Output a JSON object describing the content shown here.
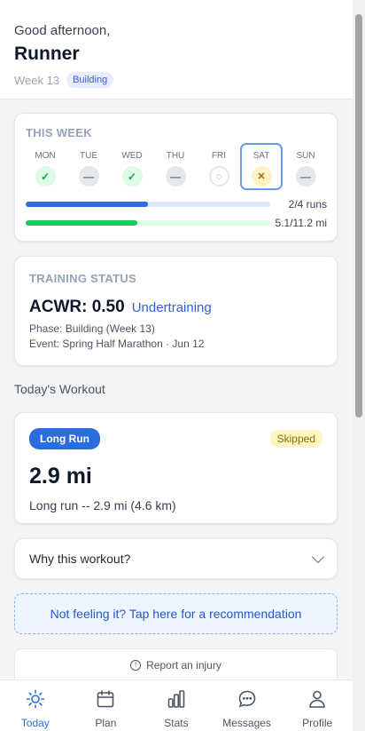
{
  "header": {
    "greeting": "Good afternoon,",
    "name": "Runner",
    "week": "Week 13",
    "phase_badge": "Building"
  },
  "this_week": {
    "title": "THIS WEEK",
    "days": [
      {
        "label": "MON",
        "state": "done",
        "icon": "check-icon"
      },
      {
        "label": "TUE",
        "state": "rest",
        "icon": "dash-icon"
      },
      {
        "label": "WED",
        "state": "done",
        "icon": "check-icon"
      },
      {
        "label": "THU",
        "state": "rest",
        "icon": "dash-icon"
      },
      {
        "label": "FRI",
        "state": "upcoming",
        "icon": "circle-icon"
      },
      {
        "label": "SAT",
        "state": "skipped",
        "icon": "x-icon",
        "selected": true
      },
      {
        "label": "SUN",
        "state": "rest",
        "icon": "dash-icon"
      }
    ],
    "runs_text": "2/4 runs",
    "runs_progress": 0.5,
    "miles_text": "5.1/11.2 mi",
    "miles_progress": 0.455
  },
  "training_status": {
    "title": "TRAINING STATUS",
    "acwr": "ACWR: 0.50",
    "status": "Undertraining",
    "phase": "Phase: Building (Week 13)",
    "event": "Event: Spring Half Marathon · Jun 12"
  },
  "today": {
    "section_title": "Today's Workout",
    "type_badge": "Long Run",
    "status_badge": "Skipped",
    "distance": "2.9 mi",
    "description": "Long run -- 2.9 mi (4.6 km)"
  },
  "why": {
    "label": "Why this workout?"
  },
  "recommendation": {
    "label": "Not feeling it? Tap here for a recommendation"
  },
  "injury": {
    "label": "Report an injury"
  },
  "nav": {
    "items": [
      {
        "label": "Today",
        "icon": "sun-icon",
        "active": true
      },
      {
        "label": "Plan",
        "icon": "calendar-icon"
      },
      {
        "label": "Stats",
        "icon": "bar-chart-icon"
      },
      {
        "label": "Messages",
        "icon": "chat-icon"
      },
      {
        "label": "Profile",
        "icon": "user-icon"
      }
    ]
  },
  "colors": {
    "accent": "#2b6de0",
    "runs_bar": "#2b6de0",
    "runs_track": "#dbe8fb",
    "miles_bar": "#22c55e",
    "miles_track": "#dcfce7"
  }
}
